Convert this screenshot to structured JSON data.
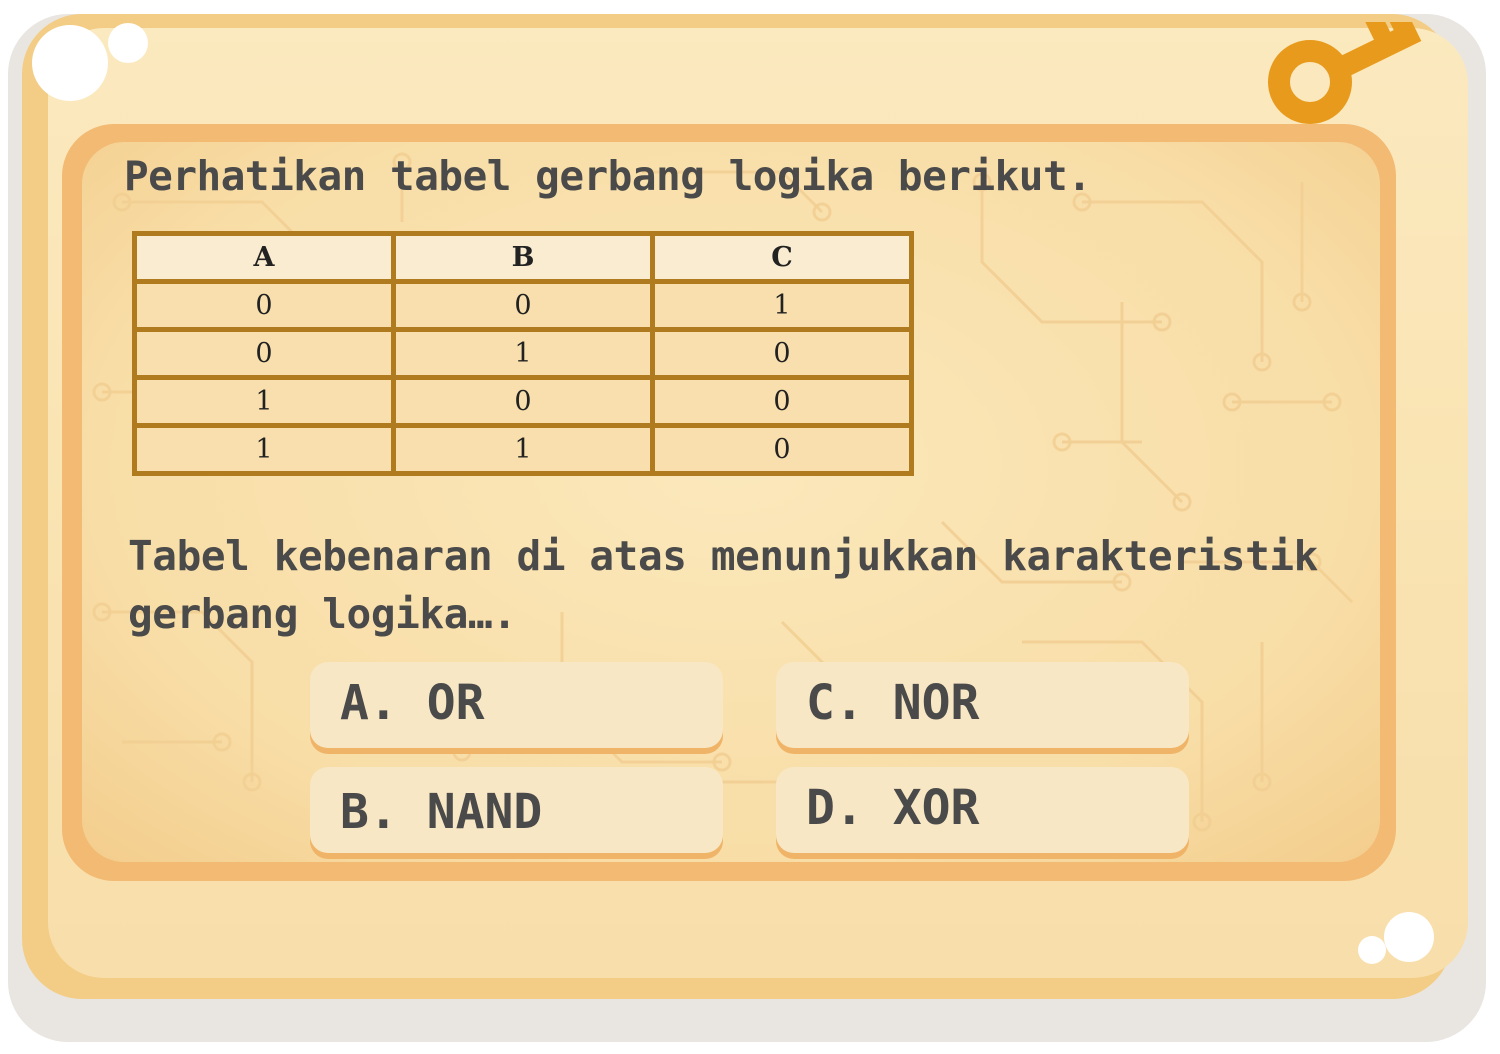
{
  "question": "Perhatikan tabel gerbang logika berikut.",
  "truth_table": {
    "headers": [
      "A",
      "B",
      "C"
    ],
    "rows": [
      [
        "0",
        "0",
        "1"
      ],
      [
        "0",
        "1",
        "0"
      ],
      [
        "1",
        "0",
        "0"
      ],
      [
        "1",
        "1",
        "0"
      ]
    ]
  },
  "statement": "Tabel kebenaran di atas menunjukkan karakteristik gerbang logika….",
  "options": [
    {
      "letter": "A.",
      "text": "OR"
    },
    {
      "letter": "B.",
      "text": "NAND"
    },
    {
      "letter": "C.",
      "text": "NOR"
    },
    {
      "letter": "D.",
      "text": "XOR"
    }
  ],
  "icons": {
    "corner": "key-icon"
  },
  "colors": {
    "card": "#f3cd86",
    "panel_border": "#f2ba73",
    "table_border": "#b07b1e",
    "key": "#e89a1c",
    "text": "#4a4a4a"
  }
}
